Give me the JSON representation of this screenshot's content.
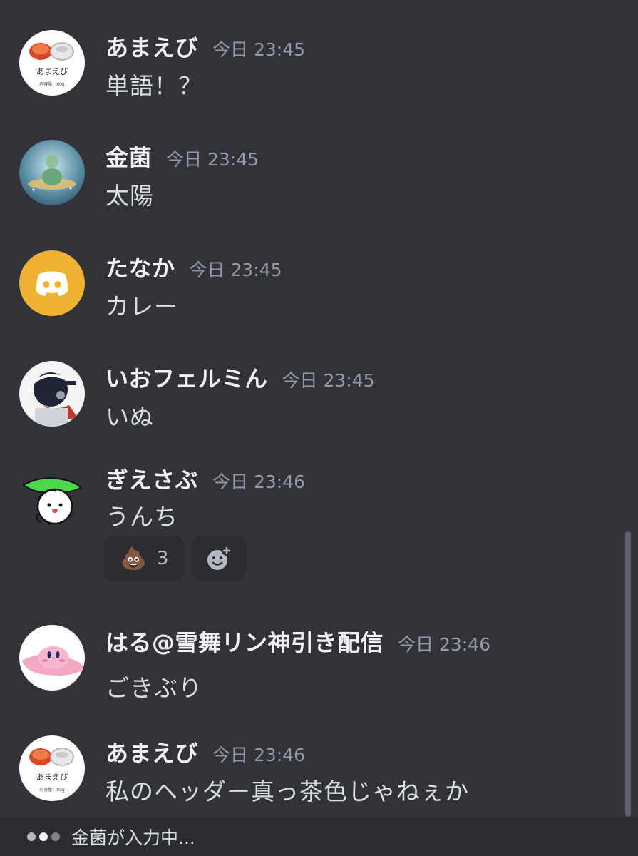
{
  "messages": [
    {
      "username": "あまえび",
      "timestamp": "今日 23:45",
      "content": "単語！？",
      "avatar": "amaebi-avatar",
      "avatar_text": {
        "label": "あまえび",
        "sub": "内容量：80g"
      }
    },
    {
      "username": "金菌",
      "timestamp": "今日 23:45",
      "content": "太陽",
      "avatar": "kinkin-avatar"
    },
    {
      "username": "たなか",
      "timestamp": "今日 23:45",
      "content": "カレー",
      "avatar": "discord-default-avatar"
    },
    {
      "username": "いおフェルミん",
      "timestamp": "今日 23:45",
      "content": "いぬ",
      "avatar": "iofermin-avatar"
    },
    {
      "username": "ぎえさぶ",
      "timestamp": "今日 23:46",
      "content": "うんち",
      "avatar": "giesabu-avatar",
      "reactions": [
        {
          "emoji": "💩",
          "count": "3"
        }
      ]
    },
    {
      "username": "はる@雪舞リン神引き配信",
      "timestamp": "今日 23:46",
      "content": "ごきぶり",
      "avatar": "haru-avatar"
    },
    {
      "username": "あまえび",
      "timestamp": "今日 23:46",
      "content": "私のヘッダー真っ茶色じゃねぇか",
      "avatar": "amaebi-avatar",
      "avatar_text": {
        "label": "あまえび",
        "sub": "内容量：80g"
      }
    }
  ],
  "typing_indicator": {
    "text": "金菌が入力中..."
  },
  "colors": {
    "background": "#313338",
    "username": "#f2f3f5",
    "timestamp": "#949ba4",
    "message_text": "#dbdee1",
    "discord_avatar": "#f0b232",
    "reaction_bg": "#2b2d31"
  }
}
